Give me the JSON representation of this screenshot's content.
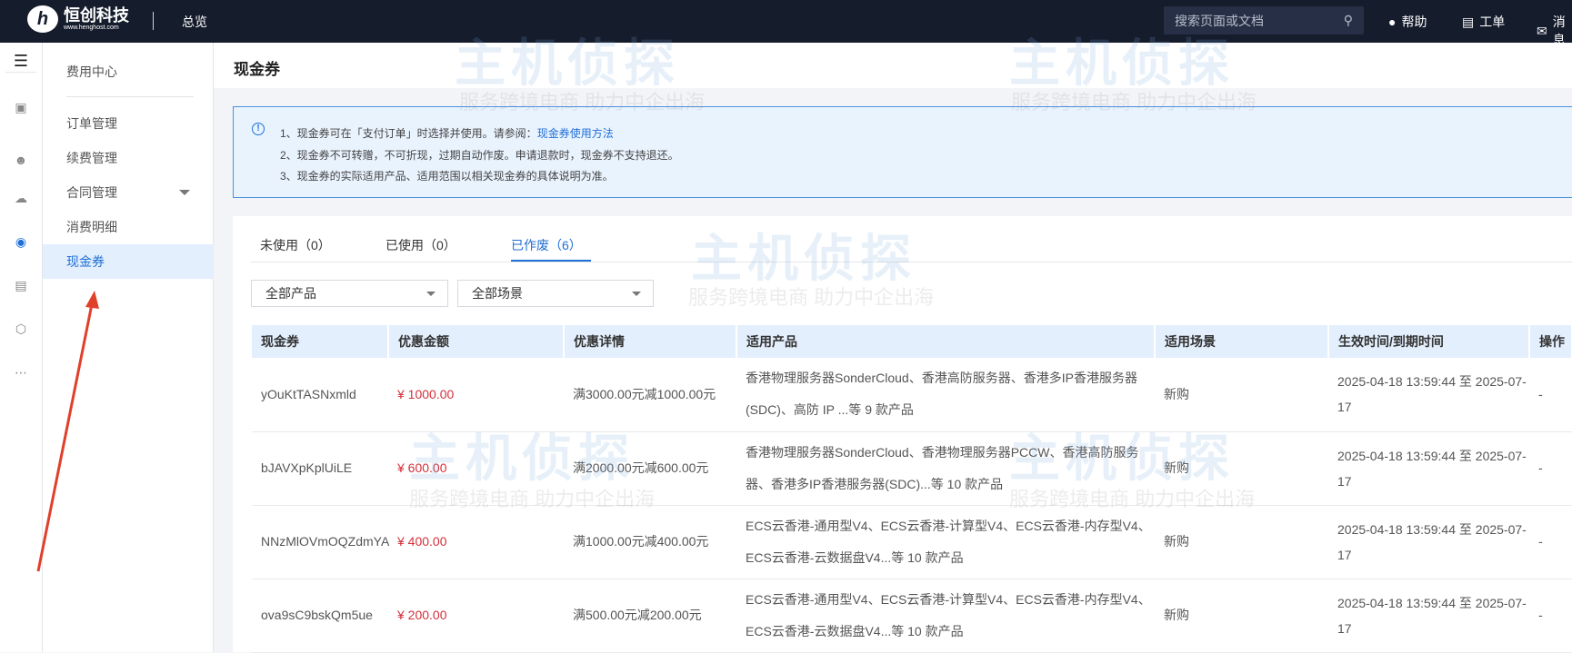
{
  "header": {
    "brand": "恒创科技",
    "brand_url": "www.henghost.com",
    "overview": "总览",
    "search_placeholder": "搜索页面或文档",
    "help": "帮助",
    "ticket": "工单",
    "messages": "消息"
  },
  "sidebar": {
    "title": "费用中心",
    "items": [
      {
        "label": "订单管理"
      },
      {
        "label": "续费管理"
      },
      {
        "label": "合同管理"
      },
      {
        "label": "消费明细"
      },
      {
        "label": "现金券",
        "active": true
      }
    ]
  },
  "page": {
    "title": "现金券"
  },
  "notice": {
    "line1": "1、现金券可在「支付订单」时选择并使用。请参阅：",
    "link": "现金券使用方法",
    "line2": "2、现金券不可转赠，不可折现，过期自动作废。申请退款时，现金券不支持退还。",
    "line3": "3、现金券的实际适用产品、适用范围以相关现金券的具体说明为准。"
  },
  "tabs": [
    {
      "label": "未使用（0）"
    },
    {
      "label": "已使用（0）"
    },
    {
      "label": "已作废（6）",
      "active": true
    }
  ],
  "filters": {
    "product": "全部产品",
    "scene": "全部场景"
  },
  "table": {
    "headers": [
      "现金券",
      "优惠金额",
      "优惠详情",
      "适用产品",
      "适用场景",
      "生效时间/到期时间",
      "操作"
    ],
    "rows": [
      [
        "yOuKtTASNxmld",
        "¥ 1000.00",
        "满3000.00元减1000.00元",
        "香港物理服务器SonderCloud、香港高防服务器、香港多IP香港服务器(SDC)、高防 IP ...等 9 款产品",
        "新购",
        "2025-04-18 13:59:44 至 2025-07-17",
        "-"
      ],
      [
        "bJAVXpKplUiLE",
        "¥ 600.00",
        "满2000.00元减600.00元",
        "香港物理服务器SonderCloud、香港物理服务器PCCW、香港高防服务器、香港多IP香港服务器(SDC)...等 10 款产品",
        "新购",
        "2025-04-18 13:59:44 至 2025-07-17",
        "-"
      ],
      [
        "NNzMlOVmOQZdmYA",
        "¥ 400.00",
        "满1000.00元减400.00元",
        "ECS云香港-通用型V4、ECS云香港-计算型V4、ECS云香港-内存型V4、ECS云香港-云数据盘V4...等 10 款产品",
        "新购",
        "2025-04-18 13:59:44 至 2025-07-17",
        "-"
      ],
      [
        "ova9sC9bskQm5ue",
        "¥ 200.00",
        "满500.00元减200.00元",
        "ECS云香港-通用型V4、ECS云香港-计算型V4、ECS云香港-内存型V4、ECS云香港-云数据盘V4...等 10 款产品",
        "新购",
        "2025-04-18 13:59:44 至 2025-07-17",
        "-"
      ]
    ]
  },
  "watermark": {
    "title": "主机侦探",
    "slogan": "服务跨境电商 助力中企出海"
  },
  "colors": {
    "header_bg": "#151c2c",
    "accent": "#1f6fd6",
    "amount": "#d4303b",
    "annotation_arrow": "#e0402a"
  }
}
